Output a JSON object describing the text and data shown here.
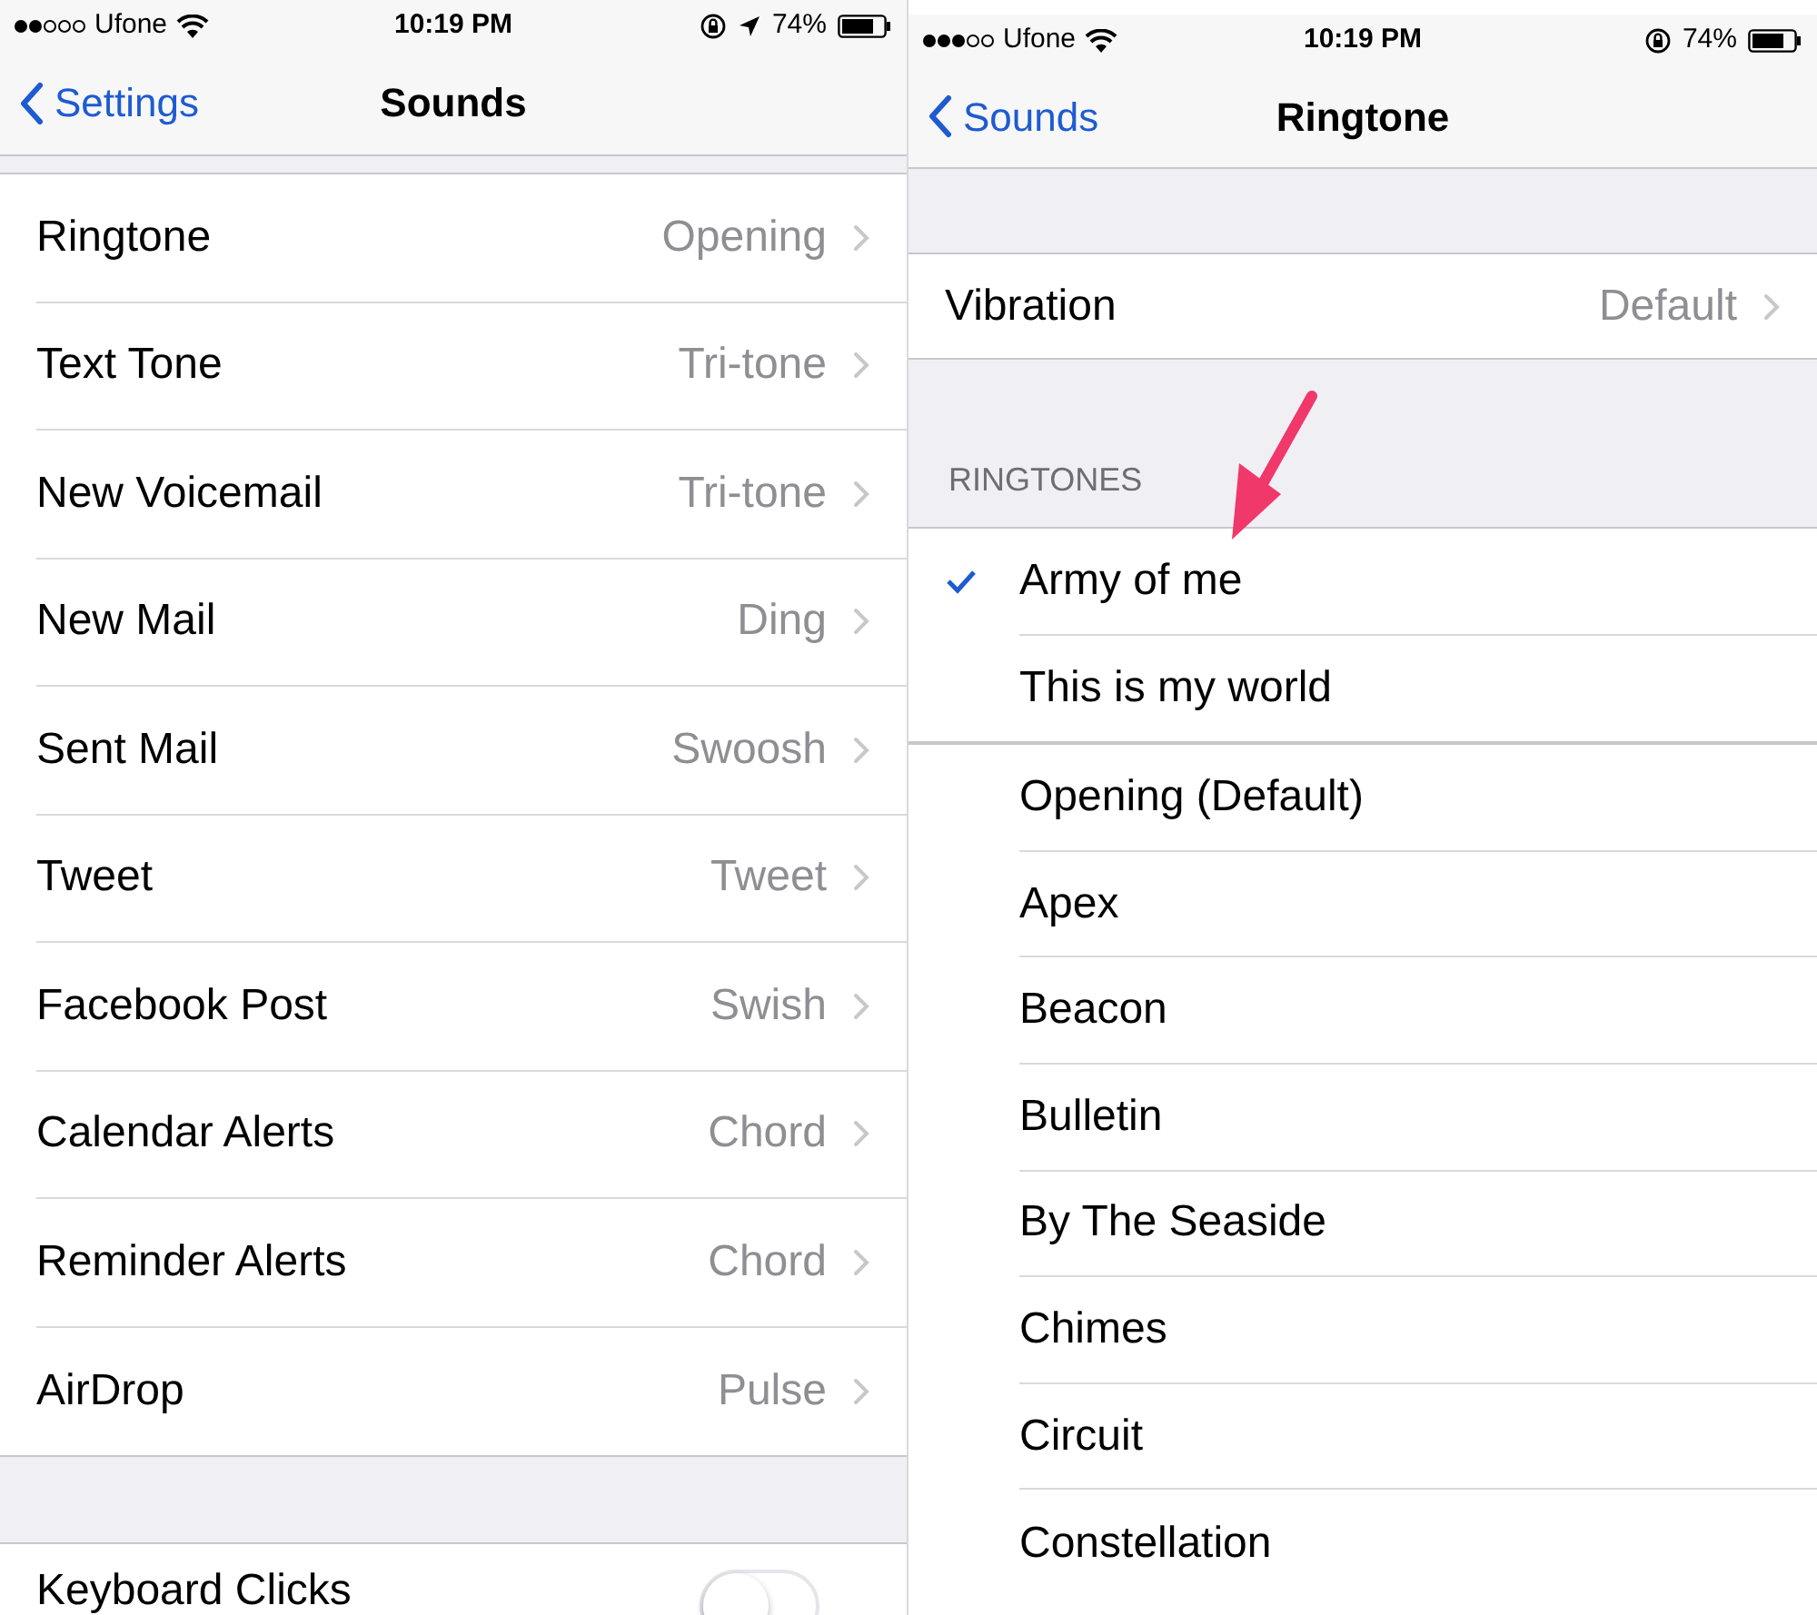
{
  "screens": [
    {
      "status_bar": {
        "carrier": "Ufone",
        "time": "10:19 PM",
        "battery": "74%",
        "location_services": true
      },
      "nav": {
        "back": "Settings",
        "title": "Sounds"
      },
      "rows": [
        {
          "label": "Ringtone",
          "value": "Opening"
        },
        {
          "label": "Text Tone",
          "value": "Tri-tone"
        },
        {
          "label": "New Voicemail",
          "value": "Tri-tone"
        },
        {
          "label": "New Mail",
          "value": "Ding"
        },
        {
          "label": "Sent Mail",
          "value": "Swoosh"
        },
        {
          "label": "Tweet",
          "value": "Tweet"
        },
        {
          "label": "Facebook Post",
          "value": "Swish"
        },
        {
          "label": "Calendar Alerts",
          "value": "Chord"
        },
        {
          "label": "Reminder Alerts",
          "value": "Chord"
        },
        {
          "label": "AirDrop",
          "value": "Pulse"
        }
      ],
      "toggles": [
        {
          "label": "Keyboard Clicks",
          "on": false
        }
      ]
    },
    {
      "status_bar": {
        "carrier": "Ufone",
        "time": "10:19 PM",
        "battery": "74%"
      },
      "nav": {
        "back": "Sounds",
        "title": "Ringtone"
      },
      "rows": [
        {
          "label": "Vibration",
          "value": "Default"
        }
      ],
      "section_header": "RINGTONES",
      "custom_tones": [
        {
          "label": "Army of me",
          "selected": true
        },
        {
          "label": "This is my world",
          "selected": false
        }
      ],
      "tones": [
        {
          "label": "Opening (Default)",
          "selected": false
        },
        {
          "label": "Apex",
          "selected": false
        },
        {
          "label": "Beacon",
          "selected": false
        },
        {
          "label": "Bulletin",
          "selected": false
        },
        {
          "label": "By The Seaside",
          "selected": false
        },
        {
          "label": "Chimes",
          "selected": false
        },
        {
          "label": "Circuit",
          "selected": false
        },
        {
          "label": "Constellation",
          "selected": false
        }
      ]
    }
  ]
}
